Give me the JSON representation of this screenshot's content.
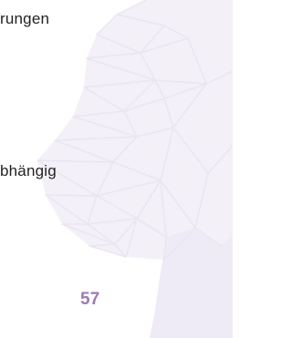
{
  "document": {
    "text_fragments": [
      "rungen",
      "bhängig"
    ],
    "page_number": "57"
  },
  "colors": {
    "text": "#222222",
    "accent": "#9a7bb8",
    "tree_fill": "#f3f0f8",
    "tree_lines": "#ebe5f2"
  },
  "decoration": {
    "icon": "low-poly-tree-illustration"
  }
}
